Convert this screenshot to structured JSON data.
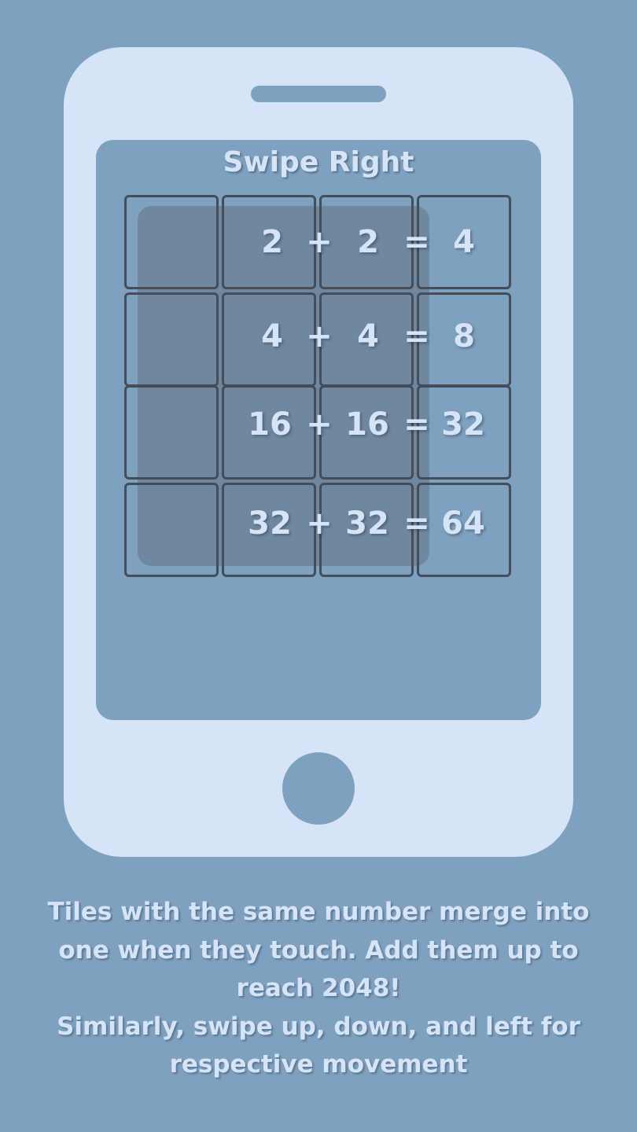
{
  "title": "Swipe Right",
  "equations": [
    {
      "a": "2",
      "op": "+",
      "b": "2",
      "eq": "=",
      "result": "4"
    },
    {
      "a": "4",
      "op": "+",
      "b": "4",
      "eq": "=",
      "result": "8"
    },
    {
      "a": "16",
      "op": "+",
      "b": "16",
      "eq": "=",
      "result": "32"
    },
    {
      "a": "32",
      "op": "+",
      "b": "32",
      "eq": "=",
      "result": "64"
    }
  ],
  "caption": {
    "line1": "Tiles with the same number merge into one when they touch. Add them up to reach 2048!",
    "line2": "Similarly, swipe up, down, and left for respective movement"
  },
  "colors": {
    "background": "#7fa1c0",
    "phone": "#d5e4f7",
    "highlight": "#6f889f",
    "tile_border": "#454d58"
  },
  "icons": {
    "phone": "smartphone-outline",
    "speaker": "phone-speaker-slot",
    "home_button": "phone-home-button"
  }
}
